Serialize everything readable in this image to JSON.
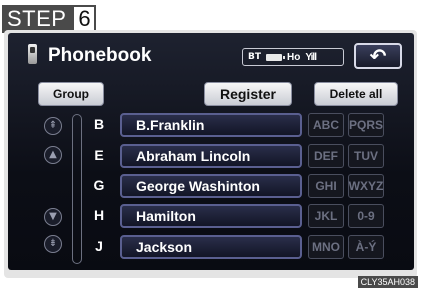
{
  "step": {
    "word": "STEP",
    "number": "6"
  },
  "header": {
    "title": "Phonebook",
    "status": {
      "bluetooth": "BT",
      "ho": "Ho",
      "signal": "Yill"
    },
    "back_glyph": "↶"
  },
  "toolbar": {
    "group_label": "Group",
    "register_label": "Register",
    "delete_all_label": "Delete all"
  },
  "scroll": {
    "page_up": "⇞",
    "up": "▲",
    "down": "▼",
    "page_down": "⇟"
  },
  "contacts": [
    {
      "letter": "B",
      "name": "B.Franklin"
    },
    {
      "letter": "E",
      "name": "Abraham Lincoln"
    },
    {
      "letter": "G",
      "name": "George Washinton"
    },
    {
      "letter": "H",
      "name": "Hamilton"
    },
    {
      "letter": "J",
      "name": "Jackson"
    }
  ],
  "index_keys": [
    [
      "ABC",
      "PQRS"
    ],
    [
      "DEF",
      "TUV"
    ],
    [
      "GHI",
      "WXYZ"
    ],
    [
      "JKL",
      "0-9"
    ],
    [
      "MNO",
      "À-Ý"
    ]
  ],
  "image_code": "CLY35AH038"
}
